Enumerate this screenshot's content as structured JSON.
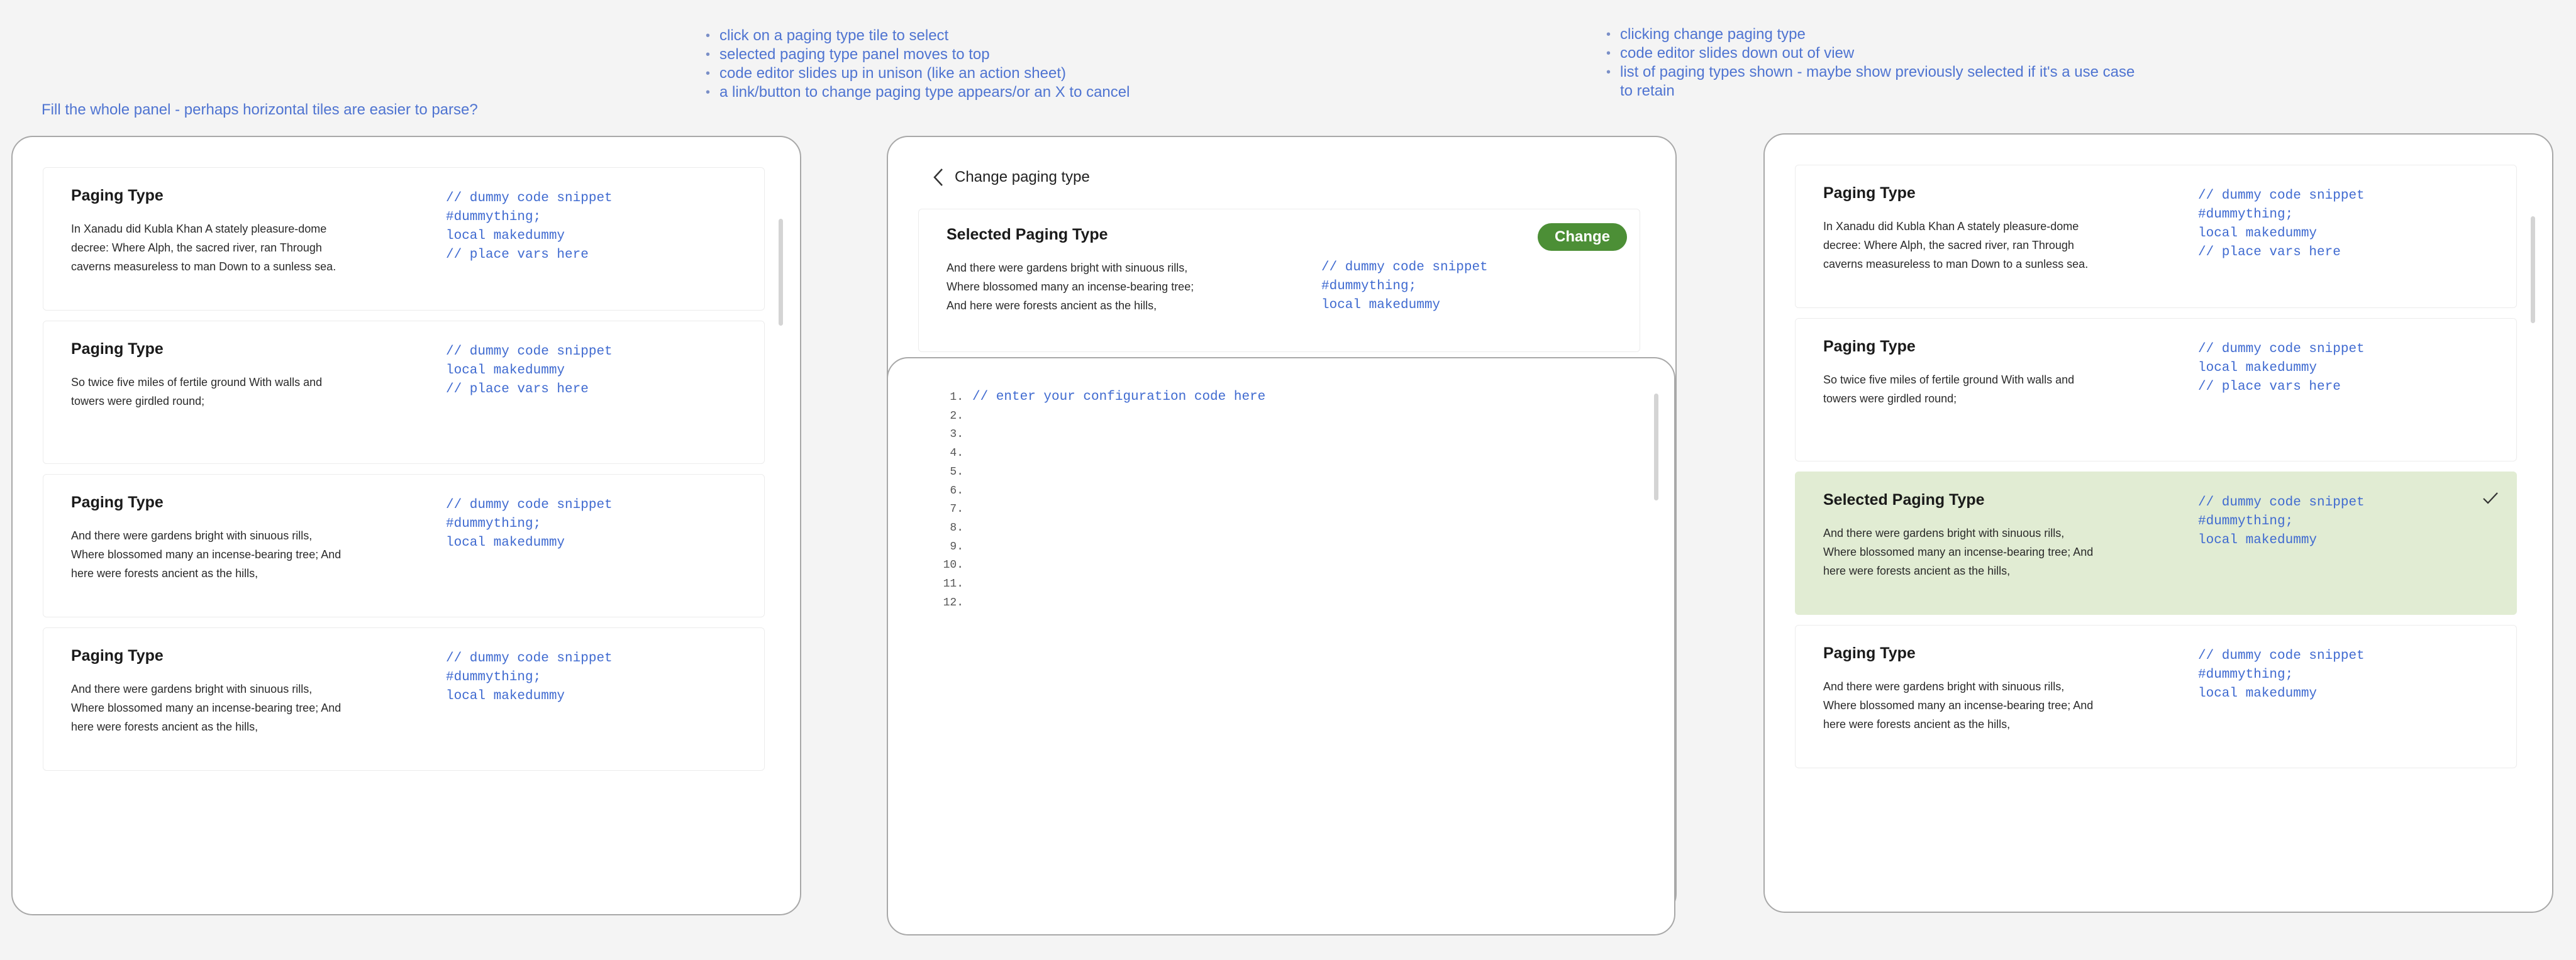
{
  "notes": {
    "left": "Fill the whole panel - perhaps horizontal tiles are easier to parse?",
    "middle": [
      "click on a paging type tile to select",
      "selected paging type panel moves to top",
      "code editor slides up in unison (like an action sheet)",
      "a link/button to change paging type appears/or an X to cancel"
    ],
    "right": [
      "clicking change paging type",
      "code editor slides down out of view",
      "list of paging types shown - maybe show previously selected if it's a use case to retain"
    ]
  },
  "left_panel": {
    "tiles": [
      {
        "title": "Paging Type",
        "desc": "In Xanadu did Kubla Khan A stately pleasure-dome decree: Where Alph, the sacred river, ran Through caverns measureless to man Down to a sunless sea.",
        "code": [
          "// dummy code snippet",
          "#dummything;",
          "local makedummy",
          "// place vars here"
        ]
      },
      {
        "title": "Paging Type",
        "desc": "So twice five miles of fertile ground  With walls and towers were girdled round;",
        "code": [
          "// dummy code snippet",
          "local makedummy",
          "// place vars here"
        ]
      },
      {
        "title": "Paging Type",
        "desc": "And there were gardens bright with sinuous rills,  Where blossomed many an incense-bearing tree;  And here were forests ancient as the hills,",
        "code": [
          "// dummy code snippet",
          "#dummything;",
          "local makedummy"
        ]
      },
      {
        "title": "Paging Type",
        "desc": "And there were gardens bright with sinuous rills,  Where blossomed many an incense-bearing tree;  And here were forests ancient as the hills,",
        "code": [
          "// dummy code snippet",
          "#dummything;",
          "local makedummy"
        ]
      }
    ]
  },
  "middle_panel": {
    "back_label": "Change paging type",
    "selected": {
      "title": "Selected Paging Type",
      "desc": "And there were gardens bright with sinuous rills,  Where blossomed many an incense-bearing tree;  And here were forests ancient as the hills,",
      "code": [
        "// dummy code snippet",
        "#dummything;",
        "local makedummy"
      ],
      "button": "Change"
    },
    "editor": {
      "line_numbers": [
        "1.",
        "2.",
        "3.",
        "4.",
        "5.",
        "6.",
        "7.",
        "8.",
        "9.",
        "10.",
        "11.",
        "12."
      ],
      "text": "// enter your configuration code here"
    }
  },
  "right_panel": {
    "tiles": [
      {
        "title": "Paging Type",
        "desc": "In Xanadu did Kubla Khan A stately pleasure-dome decree: Where Alph, the sacred river, ran Through caverns measureless to man Down to a sunless sea.",
        "code": [
          "// dummy code snippet",
          "#dummything;",
          "local makedummy",
          "// place vars here"
        ]
      },
      {
        "title": "Paging Type",
        "desc": "So twice five miles of fertile ground  With walls and towers were girdled round;",
        "code": [
          "// dummy code snippet",
          "local makedummy",
          "// place vars here"
        ]
      },
      {
        "title": "Selected Paging Type",
        "desc": "And there were gardens bright with sinuous rills,  Where blossomed many an incense-bearing tree;  And here were forests ancient as the hills,",
        "code": [
          "// dummy code snippet",
          "#dummything;",
          "local makedummy"
        ]
      },
      {
        "title": "Paging Type",
        "desc": "And there were gardens bright with sinuous rills,  Where blossomed many an incense-bearing tree;  And here were forests ancient as the hills,",
        "code": [
          "// dummy code snippet",
          "#dummything;",
          "local makedummy"
        ]
      }
    ],
    "selected_index": 2
  },
  "colors": {
    "accent": "#4f74d1",
    "code": "#3f6ad0",
    "change_button": "#4c8f36",
    "selected_tile": "#e1ecd3"
  },
  "icons": {
    "back": "chevron-left-icon",
    "selected": "check-icon"
  }
}
